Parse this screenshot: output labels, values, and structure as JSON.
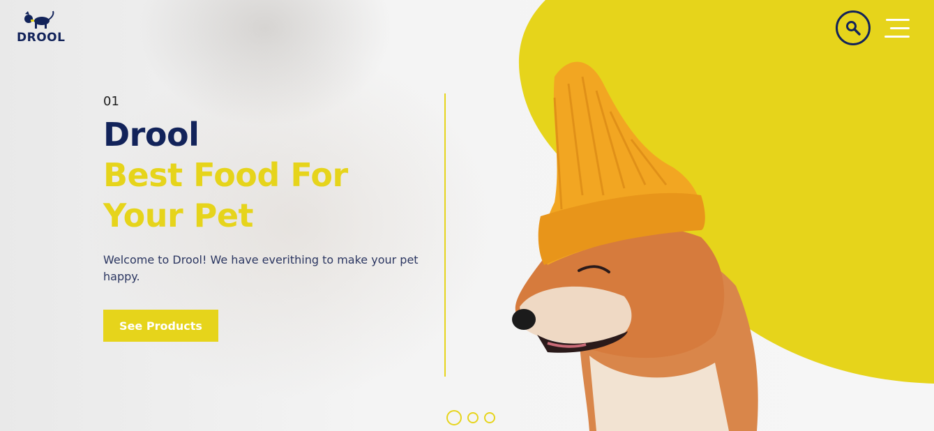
{
  "header": {
    "logo_text": "DROOL",
    "search_icon": "search-icon",
    "menu_icon": "hamburger-menu-icon"
  },
  "hero": {
    "slide_number": "01",
    "brand": "Drool",
    "tagline": "Best Food For Your Pet",
    "description": "Welcome to Drool! We have everithing to make your pet happy.",
    "cta_label": "See Products"
  },
  "slider": {
    "dots": 3,
    "active_index": 0
  },
  "colors": {
    "accent_yellow": "#e6d41b",
    "navy": "#12235a",
    "background": "#eeeeee"
  }
}
